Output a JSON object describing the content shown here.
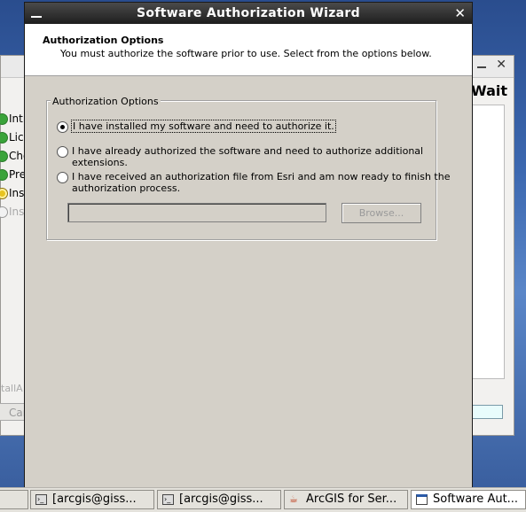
{
  "dialog": {
    "title": "Software Authorization Wizard",
    "header_title": "Authorization Options",
    "header_desc": "You must authorize the software prior to use. Select from the options below.",
    "group_label": "Authorization Options",
    "options": [
      {
        "line1": "I have installed my software and need to authorize it.",
        "line2": "",
        "checked": true
      },
      {
        "line1": "I have already authorized the software and need to authorize additional",
        "line2": "extensions.",
        "checked": false
      },
      {
        "line1": "I have received an authorization file from Esri and am now ready to finish the",
        "line2": "authorization process.",
        "checked": false
      }
    ],
    "file_path_value": "",
    "browse_label": "Browse..."
  },
  "background_window": {
    "wait_label": "Wait",
    "steps": [
      {
        "label": "Intr",
        "state": "done"
      },
      {
        "label": "Lice",
        "state": "done"
      },
      {
        "label": "Cho",
        "state": "done"
      },
      {
        "label": "Pre",
        "state": "done"
      },
      {
        "label": "Inst",
        "state": "current"
      },
      {
        "label": "Inst",
        "state": "pending"
      }
    ],
    "footer_text": "tallA",
    "cancel_label": "Can"
  },
  "taskbar": {
    "items": [
      {
        "label": "[arcgis@giss...",
        "icon": "terminal-icon"
      },
      {
        "label": "[arcgis@giss...",
        "icon": "terminal-icon"
      },
      {
        "label": "ArcGIS for Ser...",
        "icon": "java-icon"
      },
      {
        "label": "Software Aut...",
        "icon": "window-icon",
        "active": true
      }
    ]
  }
}
